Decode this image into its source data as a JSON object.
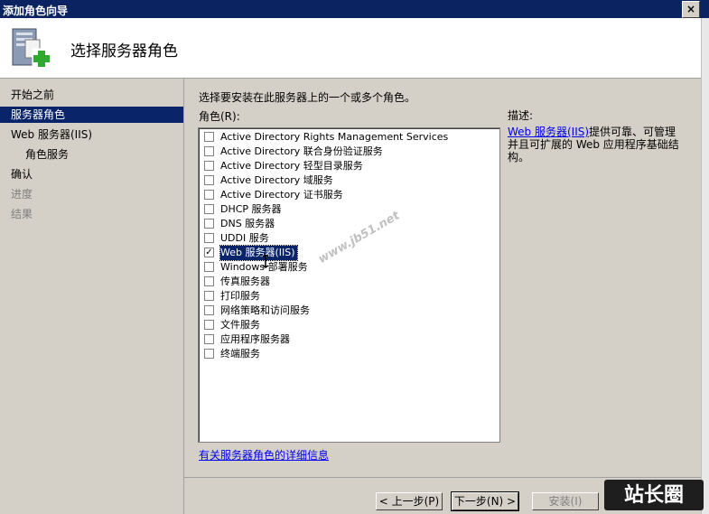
{
  "window": {
    "title": "添加角色向导",
    "close_label": "×"
  },
  "header": {
    "title": "选择服务器角色",
    "icon": "server-add-icon"
  },
  "nav": [
    {
      "label": "开始之前",
      "state": "normal"
    },
    {
      "label": "服务器角色",
      "state": "active"
    },
    {
      "label": "Web 服务器(IIS)",
      "state": "normal"
    },
    {
      "label": "角色服务",
      "state": "sub"
    },
    {
      "label": "确认",
      "state": "normal"
    },
    {
      "label": "进度",
      "state": "disabled"
    },
    {
      "label": "结果",
      "state": "disabled"
    }
  ],
  "main": {
    "instruction": "选择要安装在此服务器上的一个或多个角色。",
    "roles_label": "角色(R):",
    "roles": [
      {
        "label": "Active Directory Rights Management Services",
        "checked": false
      },
      {
        "label": "Active Directory 联合身份验证服务",
        "checked": false
      },
      {
        "label": "Active Directory 轻型目录服务",
        "checked": false
      },
      {
        "label": "Active Directory 域服务",
        "checked": false
      },
      {
        "label": "Active Directory 证书服务",
        "checked": false
      },
      {
        "label": "DHCP 服务器",
        "checked": false
      },
      {
        "label": "DNS 服务器",
        "checked": false
      },
      {
        "label": "UDDI 服务",
        "checked": false
      },
      {
        "label": "Web 服务器(IIS)",
        "checked": true,
        "selected": true
      },
      {
        "label": "Windows 部署服务",
        "checked": false
      },
      {
        "label": "传真服务器",
        "checked": false
      },
      {
        "label": "打印服务",
        "checked": false
      },
      {
        "label": "网络策略和访问服务",
        "checked": false
      },
      {
        "label": "文件服务",
        "checked": false
      },
      {
        "label": "应用程序服务器",
        "checked": false
      },
      {
        "label": "终端服务",
        "checked": false
      }
    ],
    "description_label": "描述:",
    "description_link": "Web 服务器(IIS)",
    "description_text": "提供可靠、可管理并且可扩展的 Web 应用程序基础结构。",
    "more_info_link": "有关服务器角色的详细信息"
  },
  "buttons": {
    "back": "< 上一步(P)",
    "next": "下一步(N) >",
    "install": "安装(I)"
  },
  "watermark": "www.jb51.net",
  "logo_text": "站长圈"
}
